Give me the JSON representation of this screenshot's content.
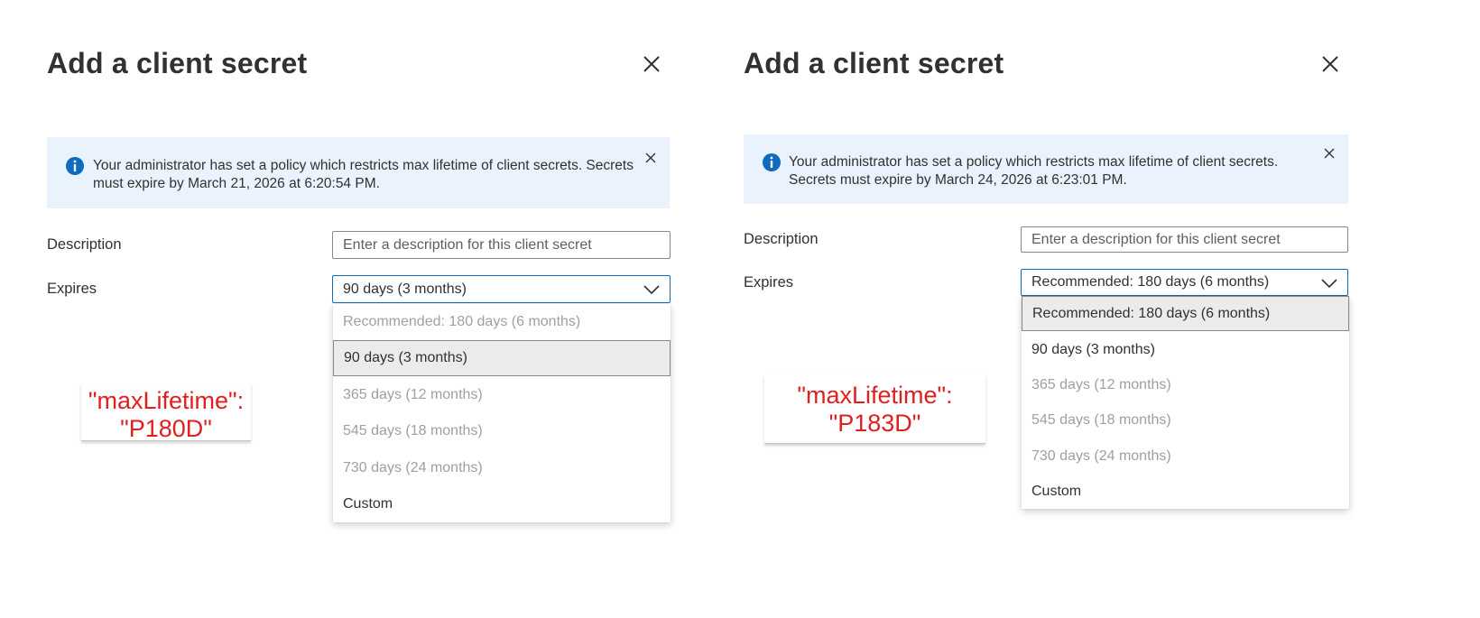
{
  "left": {
    "title": "Add a client secret",
    "banner_message": "Your administrator has set a policy which restricts max lifetime of client secrets. Secrets must expire by March 21, 2026 at 6:20:54 PM.",
    "description_label": "Description",
    "description_placeholder": "Enter a description for this client secret",
    "expires_label": "Expires",
    "expires_value": "90 days (3 months)",
    "options": [
      {
        "label": "Recommended: 180 days (6 months)",
        "state": "disabled"
      },
      {
        "label": "90 days (3 months)",
        "state": "selected"
      },
      {
        "label": "365 days (12 months)",
        "state": "disabled"
      },
      {
        "label": "545 days (18 months)",
        "state": "disabled"
      },
      {
        "label": "730 days (24 months)",
        "state": "disabled"
      },
      {
        "label": "Custom",
        "state": "enabled"
      }
    ],
    "annotation_line1": "\"maxLifetime\":",
    "annotation_line2": "\"P180D\""
  },
  "right": {
    "title": "Add a client secret",
    "banner_message": "Your administrator has set a policy which restricts max lifetime of client secrets. Secrets must expire by March 24, 2026 at 6:23:01 PM.",
    "description_label": "Description",
    "description_placeholder": "Enter a description for this client secret",
    "expires_label": "Expires",
    "expires_value": "Recommended: 180 days (6 months)",
    "options": [
      {
        "label": "Recommended: 180 days (6 months)",
        "state": "selected"
      },
      {
        "label": "90 days (3 months)",
        "state": "enabled"
      },
      {
        "label": "365 days (12 months)",
        "state": "disabled"
      },
      {
        "label": "545 days (18 months)",
        "state": "disabled"
      },
      {
        "label": "730 days (24 months)",
        "state": "disabled"
      },
      {
        "label": "Custom",
        "state": "enabled"
      }
    ],
    "annotation_line1": "\"maxLifetime\":",
    "annotation_line2": "\"P183D\""
  },
  "icons": {
    "close": "close-icon",
    "info": "info-icon",
    "dismiss": "dismiss-icon",
    "chevron": "chevron-down-icon"
  },
  "colors": {
    "banner_bg": "#eaf3fd",
    "info_blue": "#0f6cbd",
    "annotation_red": "#e02020",
    "selected_bg": "#edebe9",
    "disabled_text": "#a19f9d"
  }
}
